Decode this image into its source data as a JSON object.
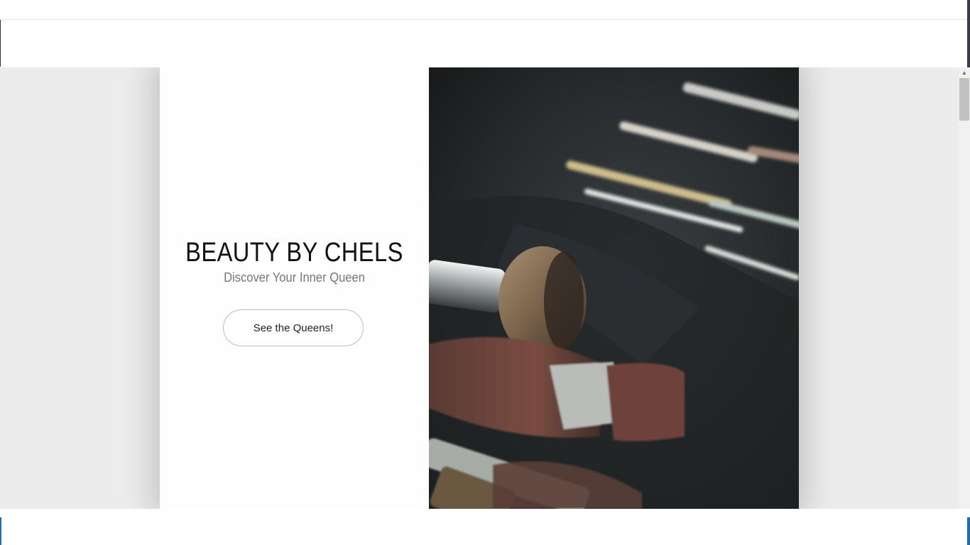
{
  "hero": {
    "title": "BEAUTY BY CHELS",
    "tagline": "Discover Your Inner Queen",
    "cta_label": "See the Queens!"
  },
  "image": {
    "subject": "makeup-brushes-photo"
  },
  "colors": {
    "page_background": "#ececec",
    "card_background": "#fefefe",
    "title_text": "#111111",
    "tagline_text": "#777777",
    "button_border": "#bdbdbd"
  }
}
